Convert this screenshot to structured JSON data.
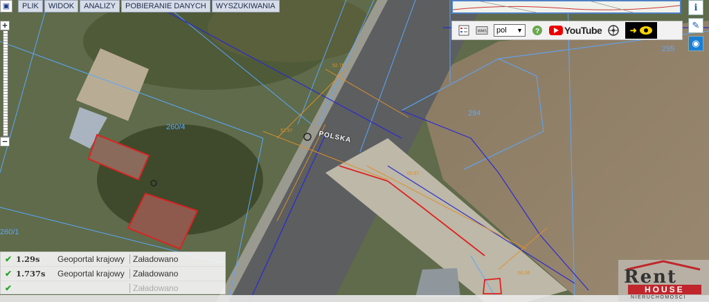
{
  "menu": [
    "PLIK",
    "WIDOK",
    "ANALIZY",
    "POBIERANIE DANYCH",
    "WYSZUKIWANIA"
  ],
  "toolbar": {
    "language": "pol",
    "youtube_label": "YouTube"
  },
  "map": {
    "road_label": "POLSKA",
    "parcels": [
      "260/4",
      "260/1",
      "294",
      "295"
    ],
    "height_labels": [
      "52.79",
      "52.97",
      "60.97",
      "60.36"
    ]
  },
  "status": [
    {
      "time": "1.29s",
      "source": "Geoportal krajowy",
      "state": "Załadowano"
    },
    {
      "time": "1.737s",
      "source": "Geoportal krajowy",
      "state": "Załadowano"
    },
    {
      "time": "",
      "source": "",
      "state": "Załadowano"
    }
  ],
  "logo": {
    "rent": "Rent",
    "house": "HOUSE",
    "sub": "NIERUCHOMOŚCI"
  },
  "colors": {
    "parcel_line": "#5aa8ff",
    "utility_orange": "#e0902a",
    "boundary_red": "#e02020",
    "road_blue": "#2a2ad0"
  }
}
